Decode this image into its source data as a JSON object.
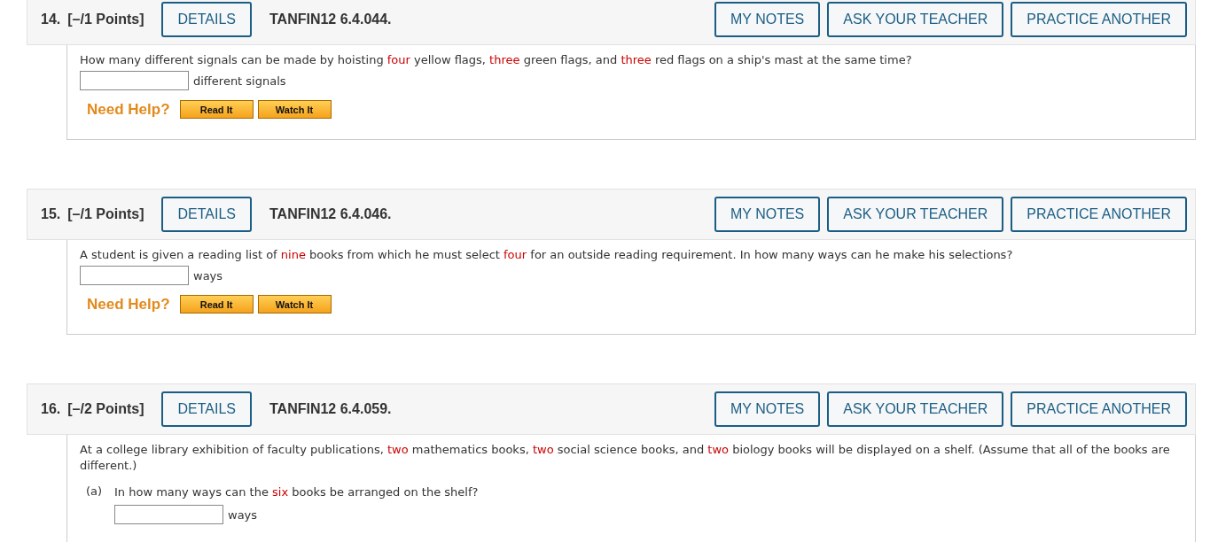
{
  "problems": [
    {
      "number": "14.",
      "points": "[–/1 Points]",
      "details": "DETAILS",
      "code": "TANFIN12 6.4.044.",
      "actions": [
        "MY NOTES",
        "ASK YOUR TEACHER",
        "PRACTICE ANOTHER"
      ],
      "question": [
        {
          "text": "How many different signals can be made by hoisting ",
          "highlight": false
        },
        {
          "text": "four",
          "highlight": true
        },
        {
          "text": " yellow flags, ",
          "highlight": false
        },
        {
          "text": "three",
          "highlight": true
        },
        {
          "text": " green flags, and ",
          "highlight": false
        },
        {
          "text": "three",
          "highlight": true
        },
        {
          "text": " red flags on a ship's mast at the same time?",
          "highlight": false
        }
      ],
      "unit": "different signals",
      "help": {
        "label": "Need Help?",
        "buttons": [
          "Read It",
          "Watch It"
        ]
      }
    },
    {
      "number": "15.",
      "points": "[–/1 Points]",
      "details": "DETAILS",
      "code": "TANFIN12 6.4.046.",
      "actions": [
        "MY NOTES",
        "ASK YOUR TEACHER",
        "PRACTICE ANOTHER"
      ],
      "question": [
        {
          "text": "A student is given a reading list of ",
          "highlight": false
        },
        {
          "text": "nine",
          "highlight": true
        },
        {
          "text": " books from which he must select ",
          "highlight": false
        },
        {
          "text": "four",
          "highlight": true
        },
        {
          "text": " for an outside reading requirement. In how many ways can he make his selections?",
          "highlight": false
        }
      ],
      "unit": "ways",
      "help": {
        "label": "Need Help?",
        "buttons": [
          "Read It",
          "Watch It"
        ]
      }
    },
    {
      "number": "16.",
      "points": "[–/2 Points]",
      "details": "DETAILS",
      "code": "TANFIN12 6.4.059.",
      "actions": [
        "MY NOTES",
        "ASK YOUR TEACHER",
        "PRACTICE ANOTHER"
      ],
      "question": [
        {
          "text": "At a college library exhibition of faculty publications, ",
          "highlight": false
        },
        {
          "text": "two",
          "highlight": true
        },
        {
          "text": " mathematics books, ",
          "highlight": false
        },
        {
          "text": "two",
          "highlight": true
        },
        {
          "text": " social science books, and ",
          "highlight": false
        },
        {
          "text": "two",
          "highlight": true
        },
        {
          "text": " biology books will be displayed on a shelf. (Assume that all of the books are different.)",
          "highlight": false
        }
      ],
      "parts": [
        {
          "label": "(a)",
          "question": [
            {
              "text": "In how many ways can the ",
              "highlight": false
            },
            {
              "text": "six",
              "highlight": true
            },
            {
              "text": " books be arranged on the shelf?",
              "highlight": false
            }
          ],
          "unit": "ways"
        }
      ]
    }
  ]
}
